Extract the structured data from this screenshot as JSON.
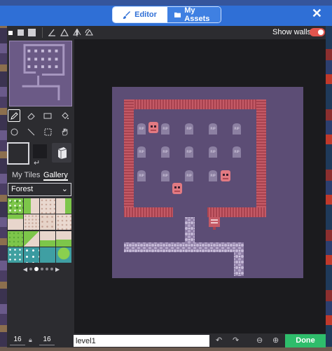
{
  "header": {
    "tabs": [
      {
        "label": "Editor",
        "icon": "paintbrush-icon",
        "active": true
      },
      {
        "label": "My Assets",
        "icon": "folder-icon",
        "active": false
      }
    ],
    "close_icon": "close-icon",
    "accent": "#2f6fd6"
  },
  "toolbar": {
    "walls_label": "Show walls",
    "walls_on": true,
    "toggle_color": "#e2554e"
  },
  "panel": {
    "tabs": [
      "My Tiles",
      "Gallery"
    ],
    "selected_tab": "Gallery",
    "tileset": "Forest"
  },
  "bottom": {
    "width": "16",
    "height": "16",
    "level_name": "level1",
    "done_label": "Done",
    "done_color": "#2ebd6b"
  },
  "map": {
    "gravestone_text": "RIP"
  }
}
